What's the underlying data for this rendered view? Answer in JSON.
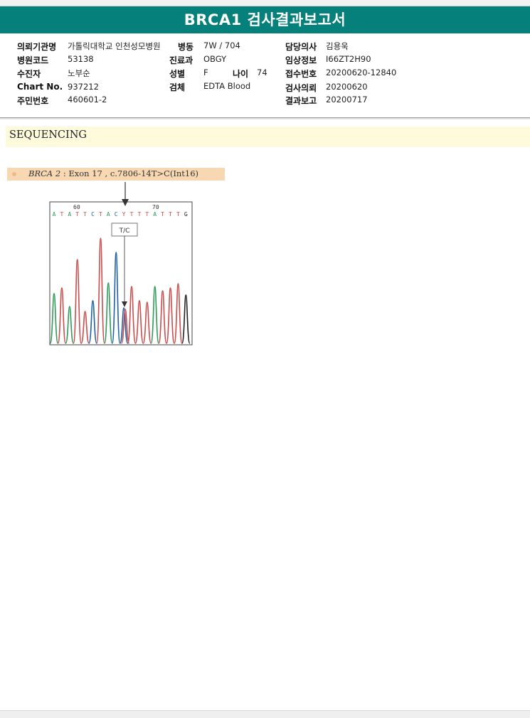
{
  "report": {
    "title": "BRCA1 검사결과보고서"
  },
  "patient": {
    "institution_label": "의뢰기관명",
    "institution_value": "가톨릭대학교 인천성모병원",
    "ward_label": "병동",
    "ward_value": "7W / 704",
    "doctor_label": "담당의사",
    "doctor_value": "김용욱",
    "hospital_code_label": "병원코드",
    "hospital_code_value": "53138",
    "department_label": "진료과",
    "department_value": "OBGY",
    "clinical_info_label": "임상정보",
    "clinical_info_value": "I66ZT2H90",
    "examinee_label": "수진자",
    "examinee_value": "노부순",
    "sex_label": "성별",
    "sex_value": "F",
    "age_label": "나이",
    "age_value": "74",
    "receipt_no_label": "접수번호",
    "receipt_no_value": "20200620-12840",
    "chart_no_label": "Chart No.",
    "chart_no_value": "937212",
    "specimen_label": "검체",
    "specimen_value": "EDTA Blood",
    "request_date_label": "검사의뢰",
    "request_date_value": "20200620",
    "id_no_label": "주민번호",
    "id_no_value": "460601-2",
    "report_date_label": "결과보고",
    "report_date_value": "20200717"
  },
  "sequencing": {
    "section_title": "SEQUENCING",
    "variant_gene": "BRCA 2",
    "variant_detail": ": Exon 17 , c.7806-14T>C(Int16)",
    "chromatogram": {
      "base_calls": "ATATTCTACYTTTATTTG",
      "position_labels": [
        "60",
        "70"
      ],
      "call_label": "T/C",
      "colors": {
        "A": "#2e9a5a",
        "T": "#cc4b4b",
        "C": "#1f5fa8",
        "G": "#222222"
      }
    }
  }
}
